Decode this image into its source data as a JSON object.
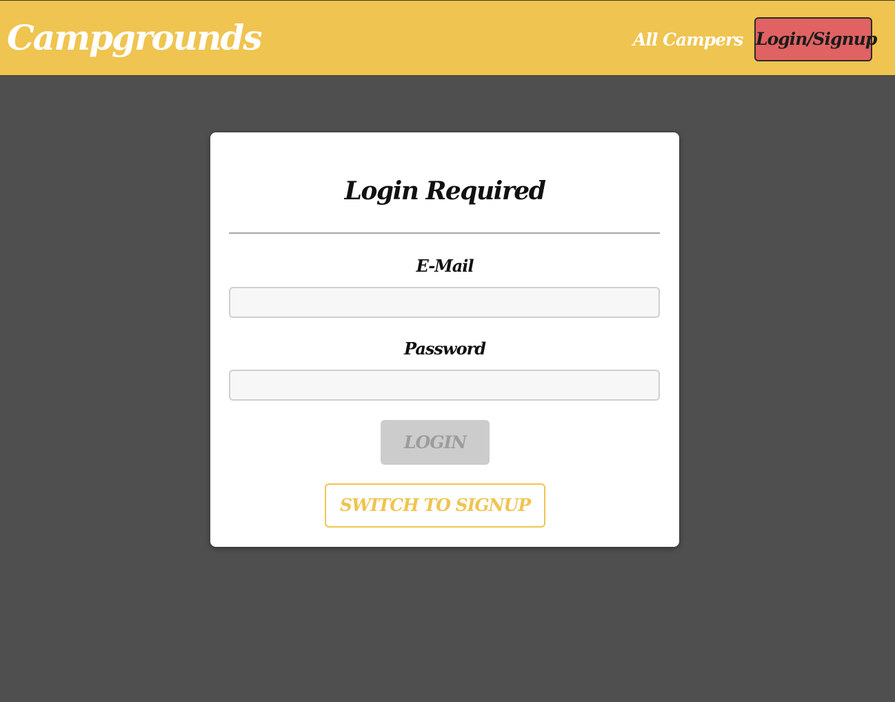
{
  "header": {
    "brand": "Campgrounds",
    "nav_all_campers": "All Campers",
    "nav_login_signup": "Login/Signup",
    "background_color": "#efc450",
    "login_signup_color": "#e06262"
  },
  "auth_card": {
    "title": "Login Required",
    "email_label": "E-Mail",
    "email_value": "",
    "password_label": "Password",
    "password_value": "",
    "login_button": "LOGIN",
    "login_button_state": "disabled",
    "switch_button": "SWITCH TO SIGNUP",
    "accent_color": "#efc450"
  },
  "page": {
    "background_color": "#4f4f4f"
  }
}
